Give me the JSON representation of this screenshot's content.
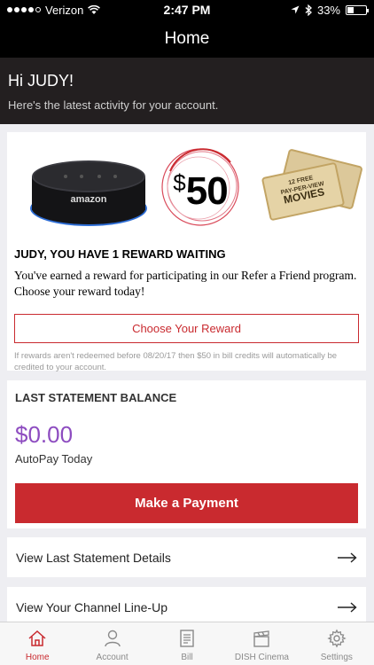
{
  "status_bar": {
    "carrier": "Verizon",
    "time": "2:47 PM",
    "battery": "33%",
    "battery_level": 0.33
  },
  "nav": {
    "title": "Home"
  },
  "greeting": {
    "title": "Hi JUDY!",
    "subtitle": "Here's the latest activity for your account."
  },
  "reward": {
    "speaker_logo": "amazon",
    "badge_symbol": "$",
    "badge_amount": "50",
    "ticket_line1": "12 FREE",
    "ticket_line2": "PAY-PER-VIEW",
    "ticket_title": "MOVIES",
    "title": "JUDY, YOU HAVE 1 REWARD WAITING",
    "description": "You've earned a reward for participating in our Refer a Friend program. Choose your reward today!",
    "button_label": "Choose Your Reward",
    "note": "If rewards aren't redeemed before 08/20/17 then $50 in bill credits will automatically be credited to your account."
  },
  "balance": {
    "title": "LAST STATEMENT BALANCE",
    "amount": "$0.00",
    "subtitle": "AutoPay Today",
    "pay_button": "Make a Payment"
  },
  "links": [
    {
      "label": "View Last Statement Details"
    },
    {
      "label": "View Your Channel Line-Up"
    }
  ],
  "tabs": [
    {
      "label": "Home",
      "icon": "home-icon",
      "active": true
    },
    {
      "label": "Account",
      "icon": "person-icon",
      "active": false
    },
    {
      "label": "Bill",
      "icon": "bill-icon",
      "active": false
    },
    {
      "label": "DISH Cinema",
      "icon": "clapperboard-icon",
      "active": false
    },
    {
      "label": "Settings",
      "icon": "gear-icon",
      "active": false
    }
  ],
  "colors": {
    "accent": "#c92a2f",
    "balance": "#8d4cc0",
    "header_bg": "#000000",
    "greeting_bg": "#231f20"
  }
}
